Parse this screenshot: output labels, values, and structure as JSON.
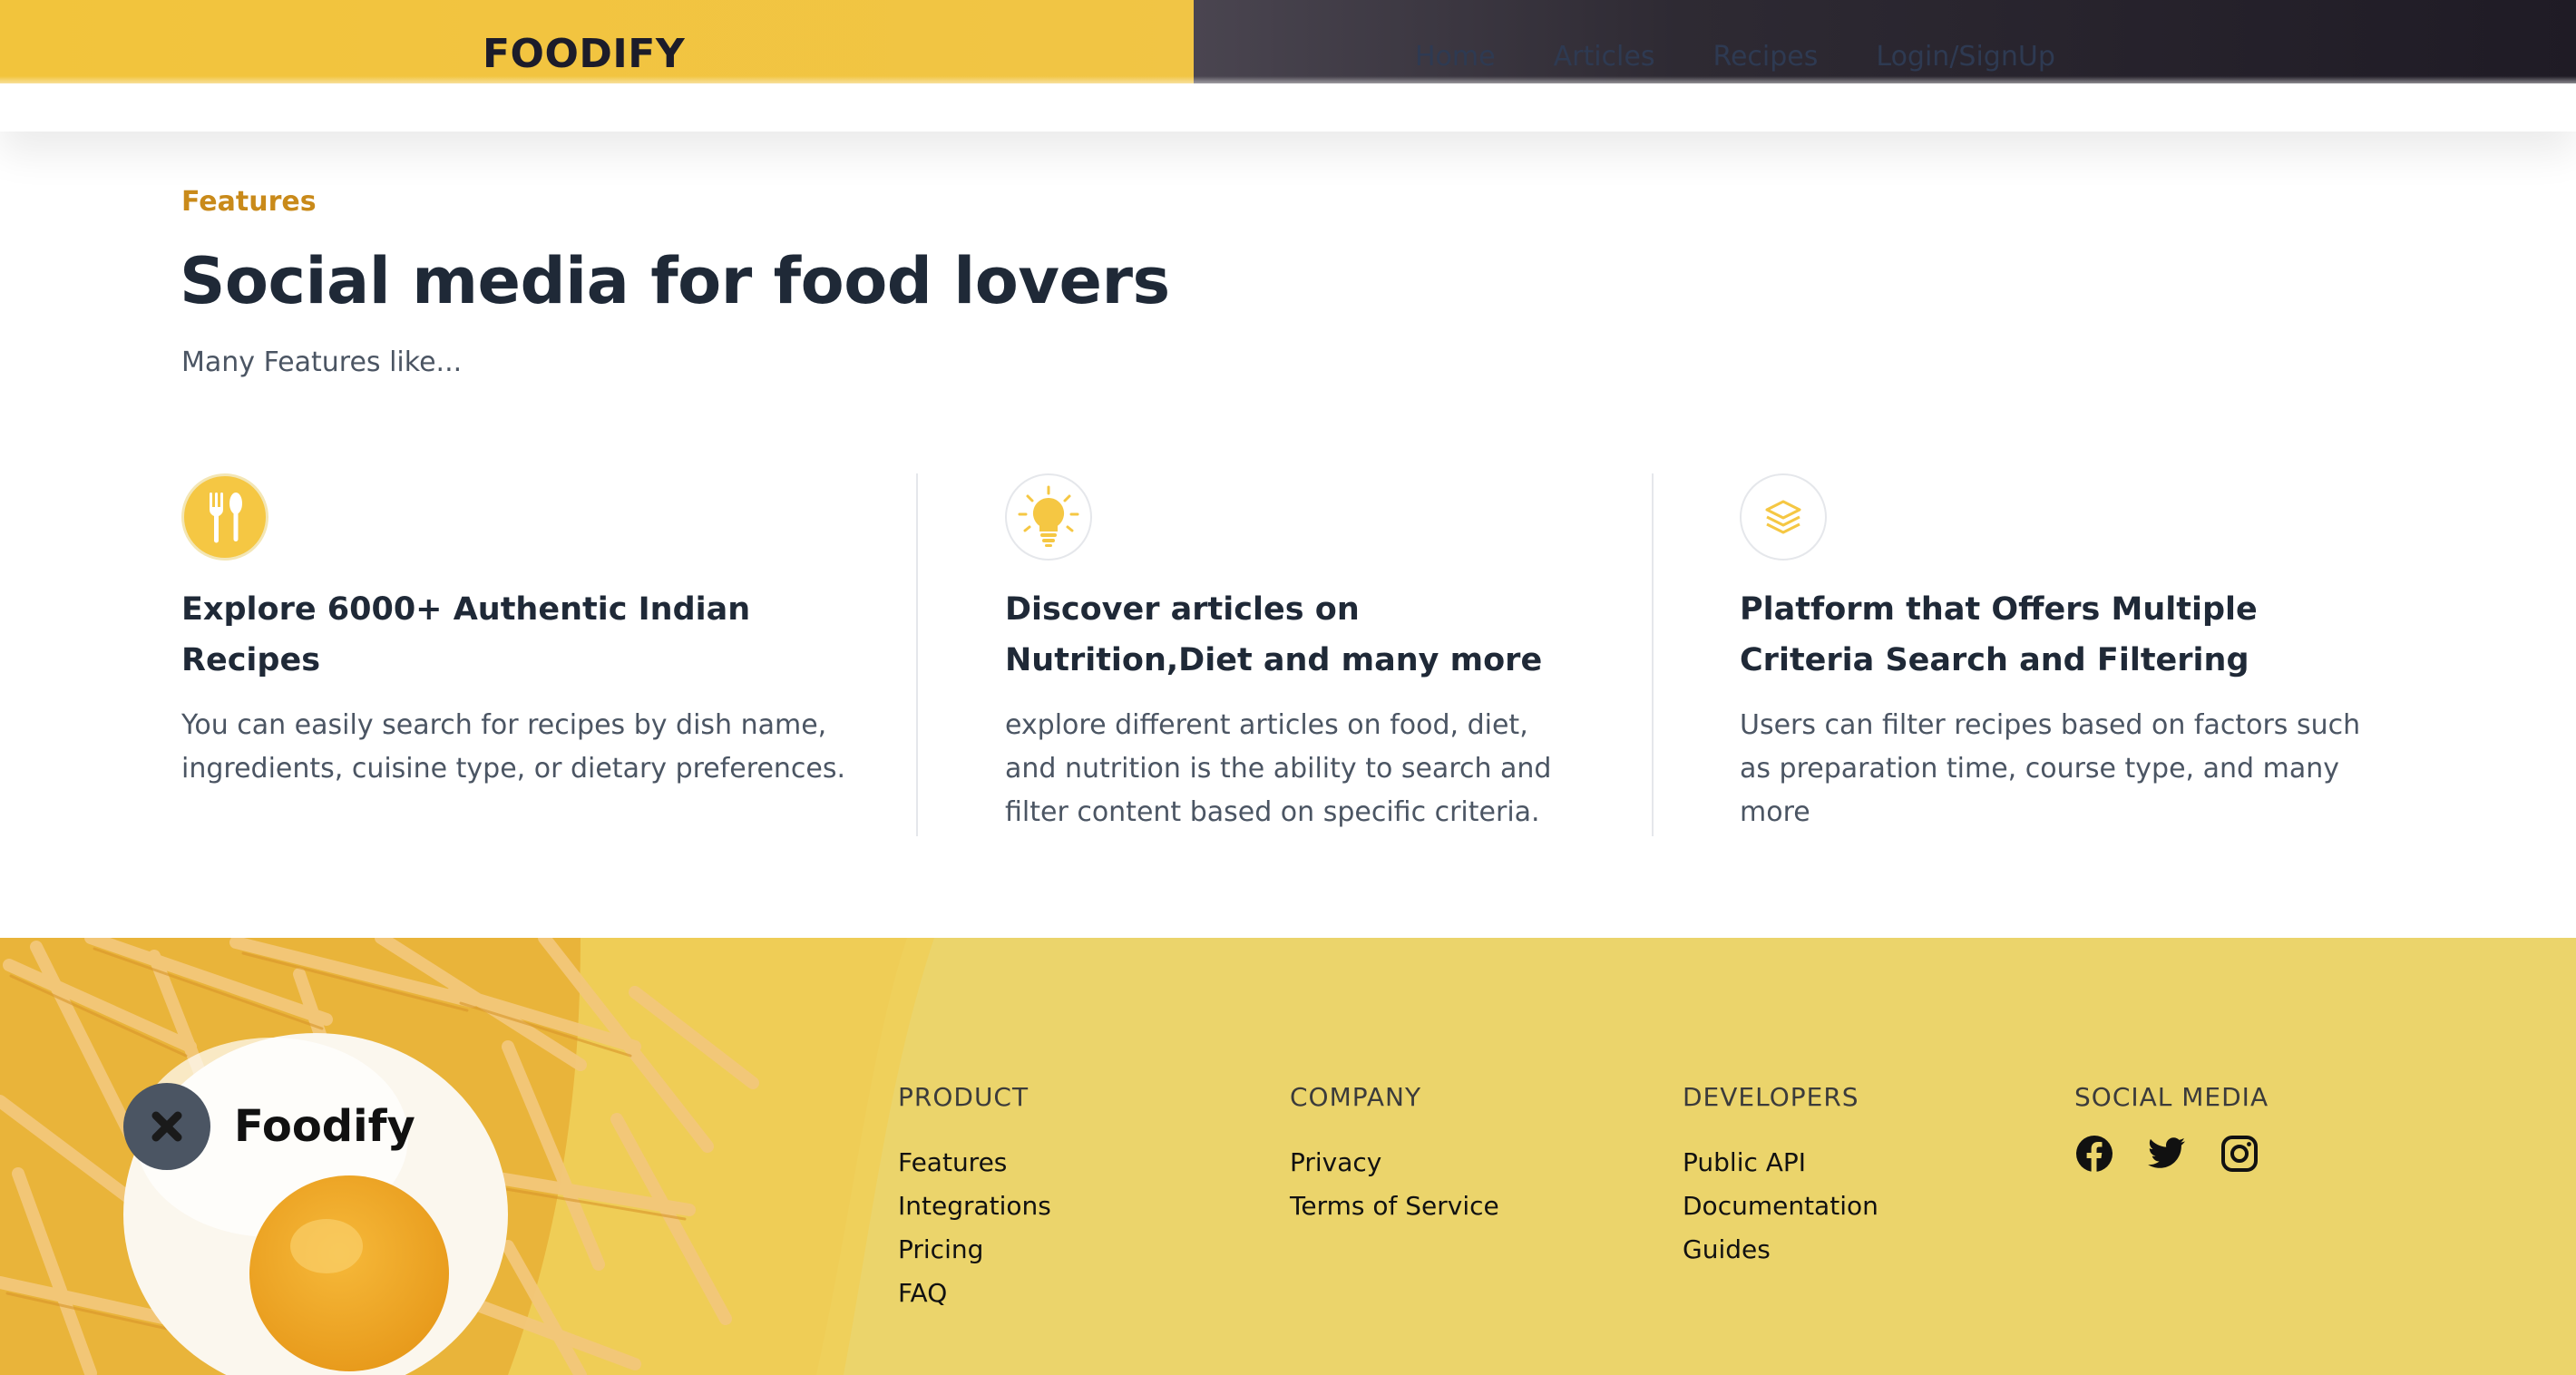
{
  "navbar": {
    "brand": "FOODIFY",
    "links": [
      "Home",
      "Articles",
      "Recipes",
      "Login/SignUp"
    ]
  },
  "features_section": {
    "eyebrow": "Features",
    "title": "Social media for food lovers",
    "subtitle": "Many Features like...",
    "items": [
      {
        "icon": "fork-spoon-icon",
        "title": "Explore 6000+ Authentic Indian Recipes",
        "text": "You can easily search for recipes by dish name, ingredients, cuisine type, or dietary preferences."
      },
      {
        "icon": "lightbulb-icon",
        "title": "Discover articles on Nutrition,Diet and many more",
        "text": "explore different articles on food, diet, and nutrition is the ability to search and filter content based on specific criteria."
      },
      {
        "icon": "layers-icon",
        "title": "Platform that Offers Multiple Criteria Search and Filtering",
        "text": "Users can filter recipes based on factors such as preparation time, course type, and many more"
      }
    ]
  },
  "footer": {
    "logo_text": "Foodify",
    "columns": [
      {
        "heading": "PRODUCT",
        "links": [
          "Features",
          "Integrations",
          "Pricing",
          "FAQ"
        ]
      },
      {
        "heading": "COMPANY",
        "links": [
          "Privacy",
          "Terms of Service"
        ]
      },
      {
        "heading": "DEVELOPERS",
        "links": [
          "Public API",
          "Documentation",
          "Guides"
        ]
      }
    ],
    "social": {
      "heading": "SOCIAL MEDIA",
      "icons": [
        "facebook-icon",
        "twitter-icon",
        "instagram-icon"
      ]
    }
  },
  "colors": {
    "accent_yellow": "#f5c743",
    "eyebrow": "#c98a1a",
    "footer_bg": "#ebd36a",
    "dark_text": "#1f2937"
  }
}
